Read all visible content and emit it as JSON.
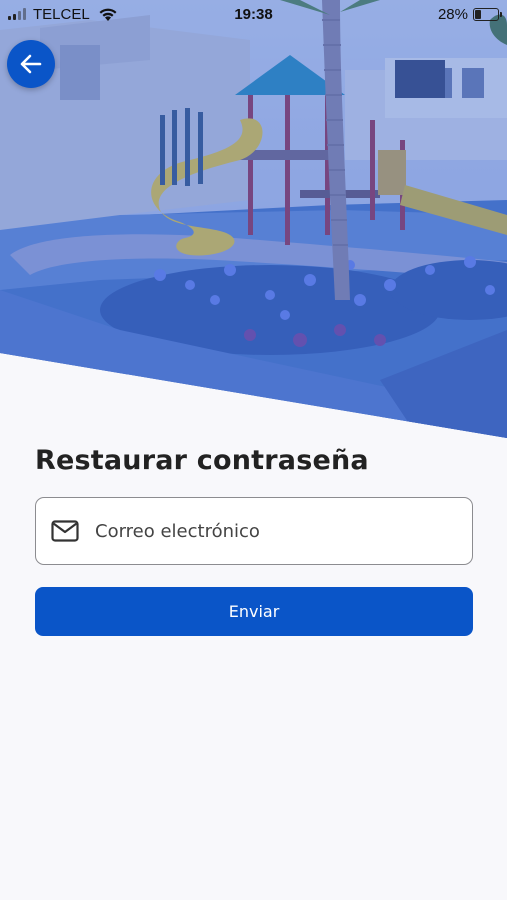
{
  "status_bar": {
    "carrier": "TELCEL",
    "time": "19:38",
    "battery_percent_label": "28%",
    "battery_level": 0.28,
    "icons": [
      "signal-icon",
      "wifi-icon",
      "battery-icon"
    ]
  },
  "header": {
    "back_icon": "arrow-left-icon",
    "image": "playground-park-photo"
  },
  "form": {
    "title": "Restaurar contraseña",
    "email": {
      "icon": "mail-icon",
      "placeholder": "Correo electrónico",
      "value": ""
    },
    "submit_label": "Enviar"
  },
  "colors": {
    "primary": "#0a55c8",
    "image_tint": "#2f5fd0",
    "background": "#f8f8fb",
    "title_text": "#222222",
    "field_border": "#8c8c90"
  }
}
